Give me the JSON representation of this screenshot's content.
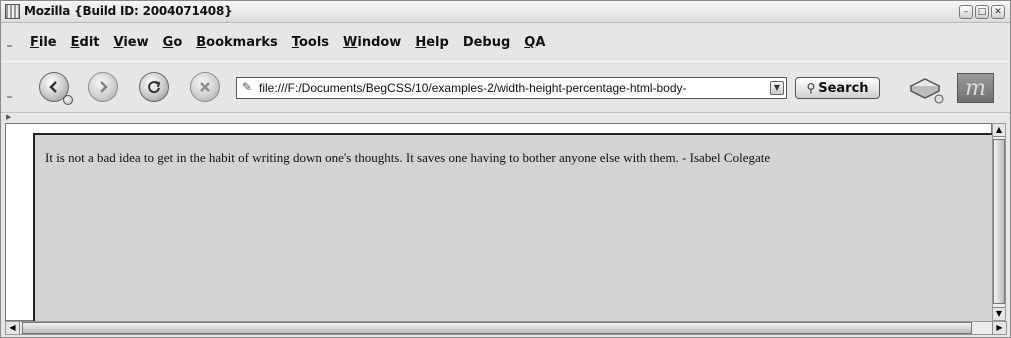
{
  "window": {
    "title": "Mozilla {Build ID: 2004071408}",
    "controls": [
      "–",
      "□",
      "✕"
    ]
  },
  "menu": {
    "items": [
      {
        "u": "F",
        "rest": "ile"
      },
      {
        "u": "E",
        "rest": "dit"
      },
      {
        "u": "V",
        "rest": "iew"
      },
      {
        "u": "G",
        "rest": "o"
      },
      {
        "u": "B",
        "rest": "ookmarks"
      },
      {
        "u": "T",
        "rest": "ools"
      },
      {
        "u": "W",
        "rest": "indow"
      },
      {
        "u": "H",
        "rest": "elp"
      },
      {
        "pre": "Debu",
        "u": "g",
        "rest": ""
      },
      {
        "u": "Q",
        "rest": "A"
      }
    ]
  },
  "toolbar": {
    "url": "file:///F:/Documents/BegCSS/10/examples-2/width-height-percentage-html-body-",
    "search_label": "Search",
    "icons": [
      "back-icon",
      "forward-icon",
      "reload-icon",
      "stop-icon",
      "print-icon",
      "mozilla-throbber-icon"
    ],
    "throbber_letter": "m"
  },
  "page": {
    "quote": "It is not a bad idea to get in the habit of writing down one's thoughts. It saves one having to bother anyone else with them. - Isabel Colegate"
  },
  "colors": {
    "chrome": "#e6e6e6",
    "page_body": "#d3d3d3"
  }
}
